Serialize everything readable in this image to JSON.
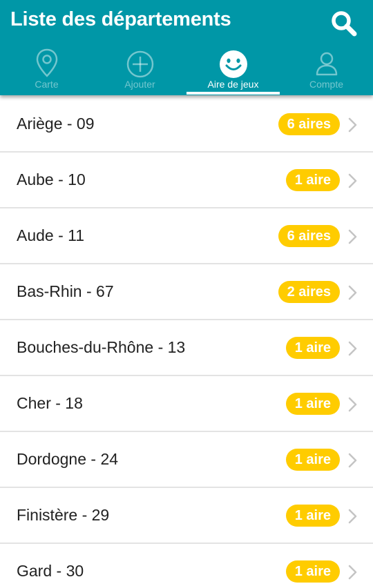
{
  "header": {
    "title": "Liste des départements",
    "search_icon": "search-icon",
    "background_color": "#0097a7"
  },
  "tabs": [
    {
      "label": "Carte",
      "icon": "map-pin-icon",
      "active": false
    },
    {
      "label": "Ajouter",
      "icon": "add-circle-icon",
      "active": false
    },
    {
      "label": "Aire de jeux",
      "icon": "smiley-icon",
      "active": true
    },
    {
      "label": "Compte",
      "icon": "user-icon",
      "active": false
    }
  ],
  "badge_color": "#ffcc00",
  "departments": [
    {
      "name": "Ariège - 09",
      "count": "6 aires"
    },
    {
      "name": "Aube - 10",
      "count": "1 aire"
    },
    {
      "name": "Aude - 11",
      "count": "6 aires"
    },
    {
      "name": "Bas-Rhin - 67",
      "count": "2 aires"
    },
    {
      "name": "Bouches-du-Rhône - 13",
      "count": "1 aire"
    },
    {
      "name": "Cher - 18",
      "count": "1 aire"
    },
    {
      "name": "Dordogne - 24",
      "count": "1 aire"
    },
    {
      "name": "Finistère - 29",
      "count": "1 aire"
    },
    {
      "name": "Gard - 30",
      "count": "1 aire"
    }
  ]
}
